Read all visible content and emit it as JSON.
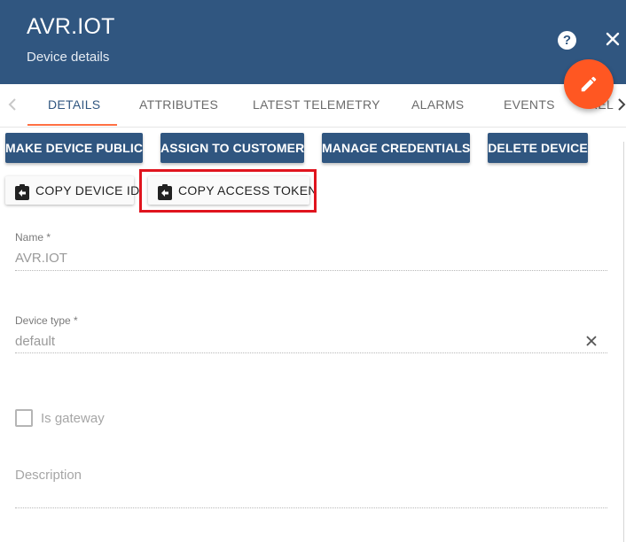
{
  "header": {
    "title": "AVR.IOT",
    "subtitle": "Device details",
    "help_icon": "help-icon",
    "help_glyph": "?",
    "close_icon": "close-icon",
    "fab_icon": "edit-icon",
    "fab_color": "#ff5722",
    "bg_color": "#305680"
  },
  "tabs": {
    "items": [
      {
        "label": "DETAILS",
        "active": true
      },
      {
        "label": "ATTRIBUTES",
        "active": false
      },
      {
        "label": "LATEST TELEMETRY",
        "active": false
      },
      {
        "label": "ALARMS",
        "active": false
      },
      {
        "label": "EVENTS",
        "active": false
      },
      {
        "label": "REL",
        "active": false
      }
    ],
    "accent_color": "#ff7043"
  },
  "actions": {
    "make_public": "MAKE DEVICE PUBLIC",
    "assign_customer": "ASSIGN TO CUSTOMER",
    "manage_credentials": "MANAGE CREDENTIALS",
    "delete_device": "DELETE DEVICE",
    "copy_device_id": "COPY DEVICE ID",
    "copy_access_token": "COPY ACCESS TOKEN",
    "copy_icon": "clipboard-arrow-icon",
    "highlight_color": "#e0141e"
  },
  "form": {
    "name_label": "Name",
    "name_value": "AVR.IOT",
    "device_type_label": "Device type",
    "device_type_value": "default",
    "required_mark": "*",
    "clear_icon": "clear-icon",
    "is_gateway_label": "Is gateway",
    "is_gateway_checked": false,
    "description_placeholder": "Description"
  }
}
